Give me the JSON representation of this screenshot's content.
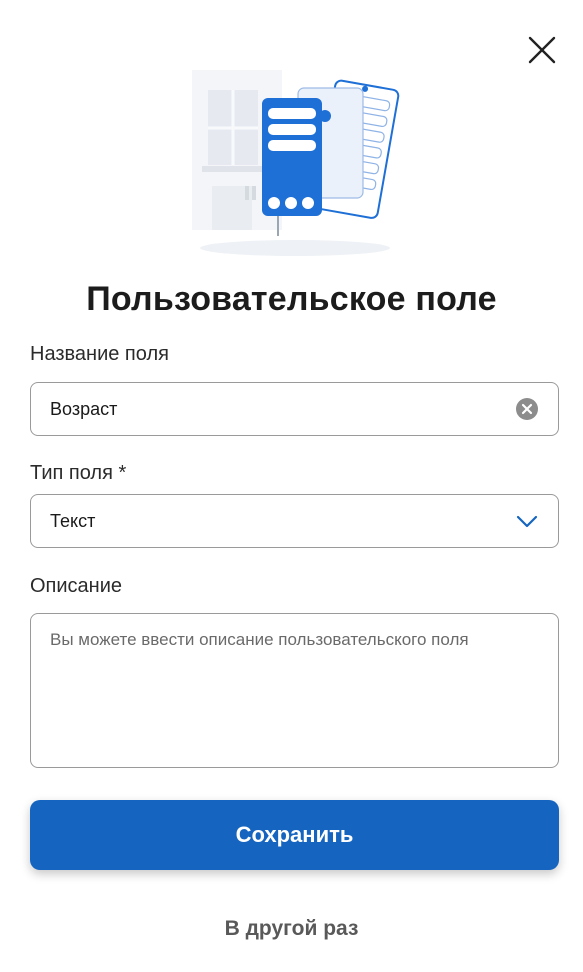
{
  "dialog": {
    "title": "Пользовательское поле",
    "close_icon": "close-icon"
  },
  "illustration": {
    "icon": "server-document-illustration",
    "colors": {
      "accent": "#1565c0",
      "light": "#e9eef5"
    }
  },
  "fields": {
    "name": {
      "label": "Название поля",
      "value": "Возраст",
      "clear_icon": "clear-circle-icon"
    },
    "type": {
      "label": "Тип поля *",
      "value": "Текст",
      "icon": "chevron-down-icon"
    },
    "description": {
      "label": "Описание",
      "placeholder": "Вы можете ввести описание пользовательского поля"
    }
  },
  "actions": {
    "save_label": "Сохранить",
    "later_label": "В другой раз"
  },
  "colors": {
    "primary": "#1565c0",
    "border": "#9a9a9a",
    "text": "#1c1c1c"
  }
}
